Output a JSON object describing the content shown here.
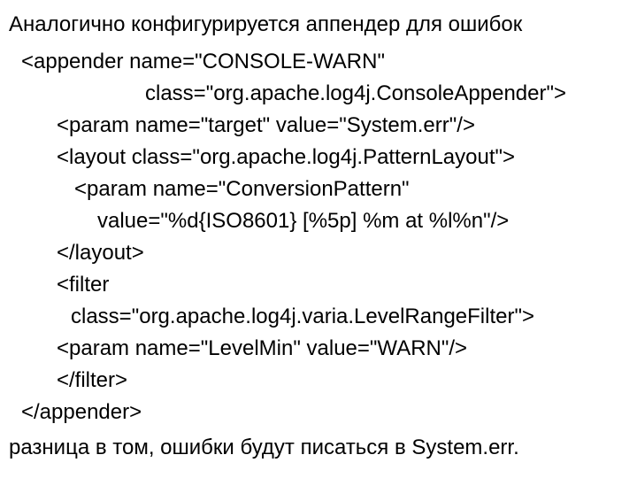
{
  "text": {
    "intro": "Аналогично конфигурируется аппендер для ошибок",
    "outro": "разница в том, ошибки будут писаться в System.err."
  },
  "code": {
    "l0": "<appender name=\"CONSOLE-WARN\"",
    "l1": "class=\"org.apache.log4j.ConsoleAppender\">",
    "l2": "<param name=\"target\" value=\"System.err\"/>",
    "l3": "<layout class=\"org.apache.log4j.PatternLayout\">",
    "l4": "<param name=\"ConversionPattern\"",
    "l5": "value=\"%d{ISO8601} [%5p] %m at %l%n\"/>",
    "l6": "</layout>",
    "l7": "<filter",
    "l8": "class=\"org.apache.log4j.varia.LevelRangeFilter\">",
    "l9": "<param name=\"LevelMin\" value=\"WARN\"/>",
    "l10": "</filter>",
    "l11": "</appender>"
  }
}
